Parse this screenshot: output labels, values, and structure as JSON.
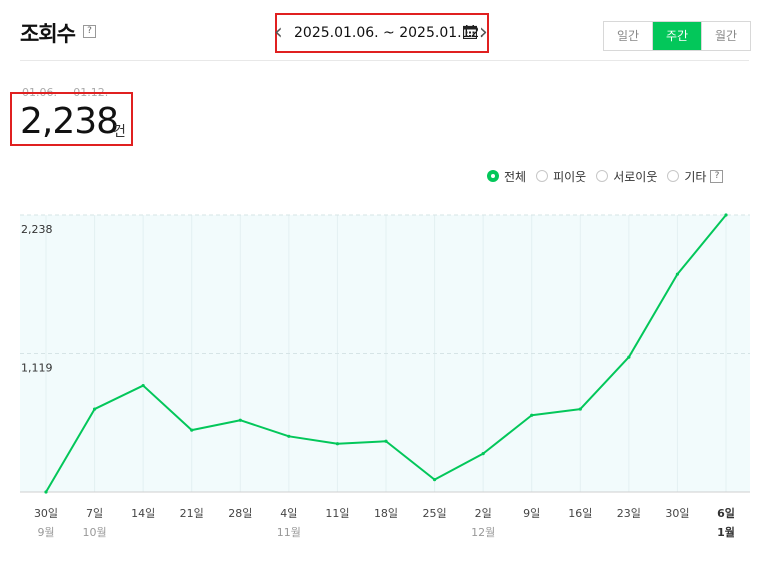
{
  "header": {
    "title": "조회수",
    "help_symbol": "?",
    "date_range": "2025.01.06. ~ 2025.01.12.",
    "prev_symbol": "‹",
    "next_symbol": "›",
    "period_tabs": [
      {
        "label": "일간",
        "active": false
      },
      {
        "label": "주간",
        "active": true
      },
      {
        "label": "월간",
        "active": false
      }
    ]
  },
  "summary": {
    "range": "01.06. ~ 01.12.",
    "total": "2,238",
    "unit": "건"
  },
  "filters": [
    {
      "label": "전체",
      "selected": true
    },
    {
      "label": "피이웃",
      "selected": false
    },
    {
      "label": "서로이웃",
      "selected": false
    },
    {
      "label": "기타",
      "selected": false
    }
  ],
  "colors": {
    "accent": "#03c75a",
    "highlight_border": "#e02020",
    "plot_background": "#f2fbfc"
  },
  "chart_data": {
    "type": "line",
    "x": [
      "30일",
      "7일",
      "14일",
      "21일",
      "28일",
      "4일",
      "11일",
      "18일",
      "25일",
      "2일",
      "9일",
      "16일",
      "23일",
      "30일",
      "6일"
    ],
    "month_labels": [
      "9월",
      "10월",
      "",
      "",
      "",
      "11월",
      "",
      "",
      "",
      "12월",
      "",
      "",
      "",
      "",
      "1월"
    ],
    "series": [
      {
        "values": [
          0,
          670,
          860,
          500,
          580,
          450,
          390,
          410,
          100,
          310,
          620,
          670,
          1090,
          1760,
          2238
        ]
      }
    ],
    "y_ticks": [
      {
        "value": 1119,
        "label": "1,119"
      },
      {
        "value": 2238,
        "label": "2,238"
      }
    ],
    "ylim": [
      0,
      2238
    ],
    "grid": true
  }
}
